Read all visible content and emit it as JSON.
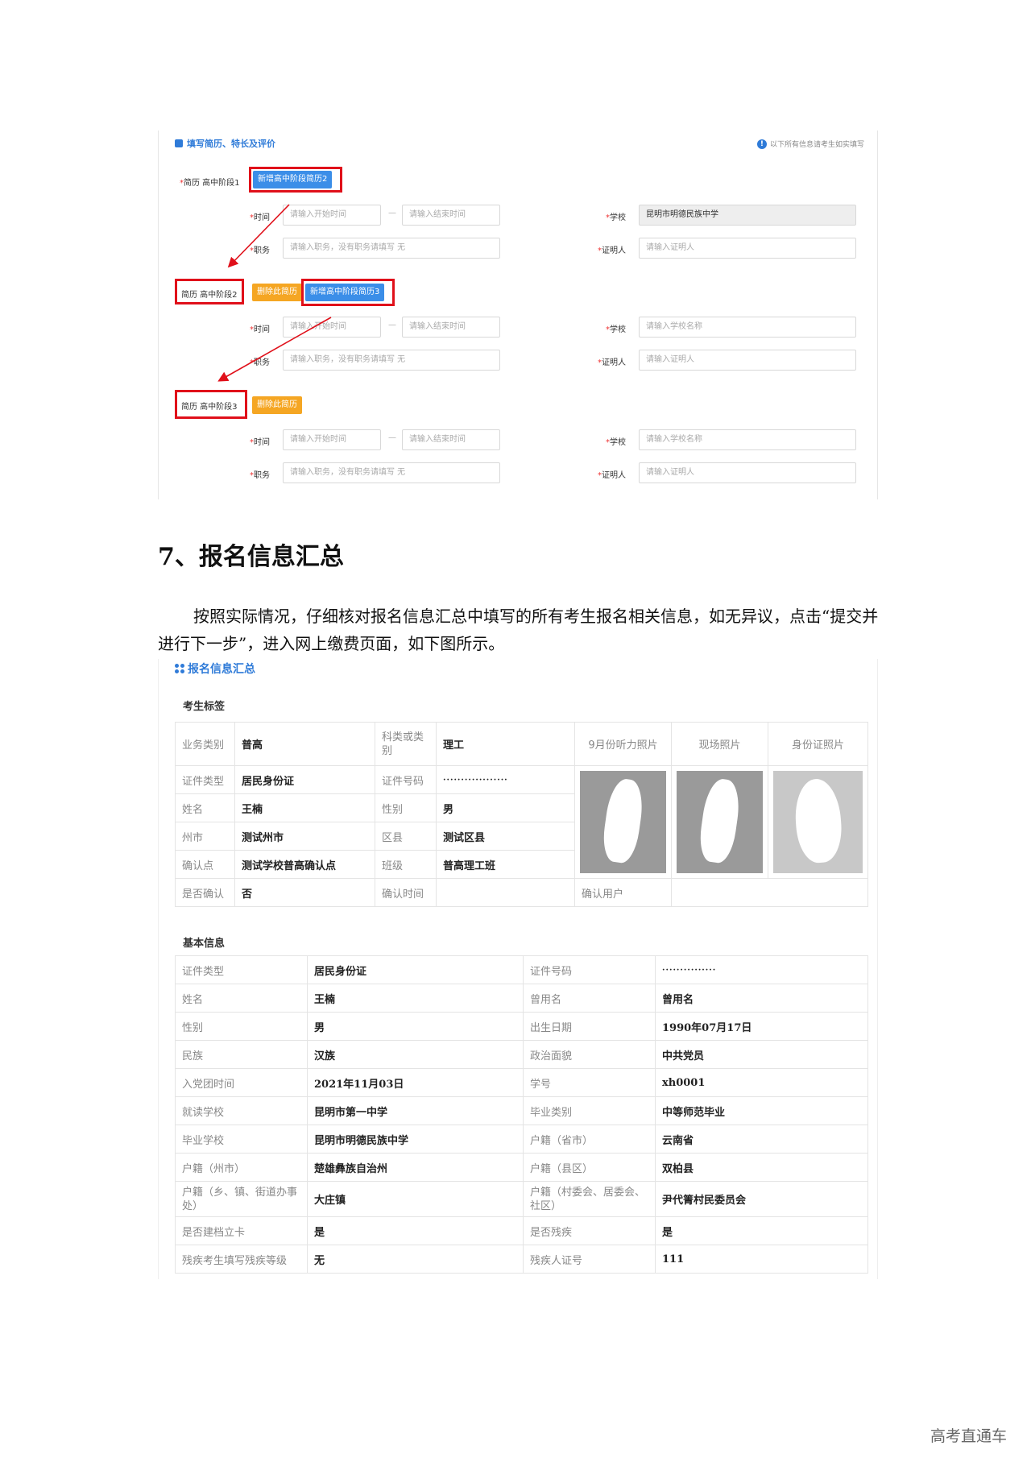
{
  "resume_form": {
    "header": "填写简历、特长及评价",
    "note": "以下所有信息请考生如实填写",
    "stages": [
      {
        "label": "简历 高中阶段1",
        "add_button": "新增高中阶段简历2",
        "school_value": "昆明市明德民族中学"
      },
      {
        "label": "简历 高中阶段2",
        "delete_button": "删除此简历",
        "add_button": "新增高中阶段简历3"
      },
      {
        "label": "简历 高中阶段3",
        "delete_button": "删除此简历"
      }
    ],
    "labels": {
      "time": "时间",
      "position": "职务",
      "school": "学校",
      "witness": "证明人"
    },
    "placeholders": {
      "start_time": "请输入开始时间",
      "end_time": "请输入结束时间",
      "position": "请输入职务，没有职务请填写 无",
      "school": "请输入学校名称",
      "witness": "请输入证明人"
    },
    "dash": "—"
  },
  "doc": {
    "heading": "7、报名信息汇总",
    "paragraph": "按照实际情况，仔细核对报名信息汇总中填写的所有考生报名相关信息，如无异议，点击“提交并进行下一步”，进入网上缴费页面，如下图所示。"
  },
  "summary": {
    "title": "报名信息汇总",
    "tags_section": "考生标签",
    "tags": {
      "business_type_k": "业务类别",
      "business_type_v": "普高",
      "subject_k": "科类或类别",
      "subject_v": "理工",
      "photo1": "9月份听力照片",
      "photo2": "现场照片",
      "photo3": "身份证照片",
      "id_type_k": "证件类型",
      "id_type_v": "居民身份证",
      "id_no_k": "证件号码",
      "id_no_v": "··················",
      "name_k": "姓名",
      "name_v": "王楠",
      "gender_k": "性别",
      "gender_v": "男",
      "city_k": "州市",
      "city_v": "测试州市",
      "county_k": "区县",
      "county_v": "测试区县",
      "confirm_point_k": "确认点",
      "confirm_point_v": "测试学校普高确认点",
      "class_k": "班级",
      "class_v": "普高理工班",
      "confirmed_k": "是否确认",
      "confirmed_v": "否",
      "confirm_time_k": "确认时间",
      "confirm_user_k": "确认用户"
    },
    "basic_section": "基本信息",
    "basic_rows": [
      [
        "证件类型",
        "居民身份证",
        "证件号码",
        "···············"
      ],
      [
        "姓名",
        "王楠",
        "曾用名",
        "曾用名"
      ],
      [
        "性别",
        "男",
        "出生日期",
        "1990年07月17日"
      ],
      [
        "民族",
        "汉族",
        "政治面貌",
        "中共党员"
      ],
      [
        "入党团时间",
        "2021年11月03日",
        "学号",
        "xh0001"
      ],
      [
        "就读学校",
        "昆明市第一中学",
        "毕业类别",
        "中等师范毕业"
      ],
      [
        "毕业学校",
        "昆明市明德民族中学",
        "户籍（省市）",
        "云南省"
      ],
      [
        "户籍（州市）",
        "楚雄彝族自治州",
        "户籍（县区）",
        "双柏县"
      ],
      [
        "户籍（乡、镇、街道办事处）",
        "大庄镇",
        "户籍（村委会、居委会、社区）",
        "尹代箐村民委员会"
      ],
      [
        "是否建档立卡",
        "是",
        "是否残疾",
        "是"
      ],
      [
        "残疾考生填写残疾等级",
        "无",
        "残疾人证号",
        "111"
      ]
    ]
  },
  "watermark": "高考直通车"
}
